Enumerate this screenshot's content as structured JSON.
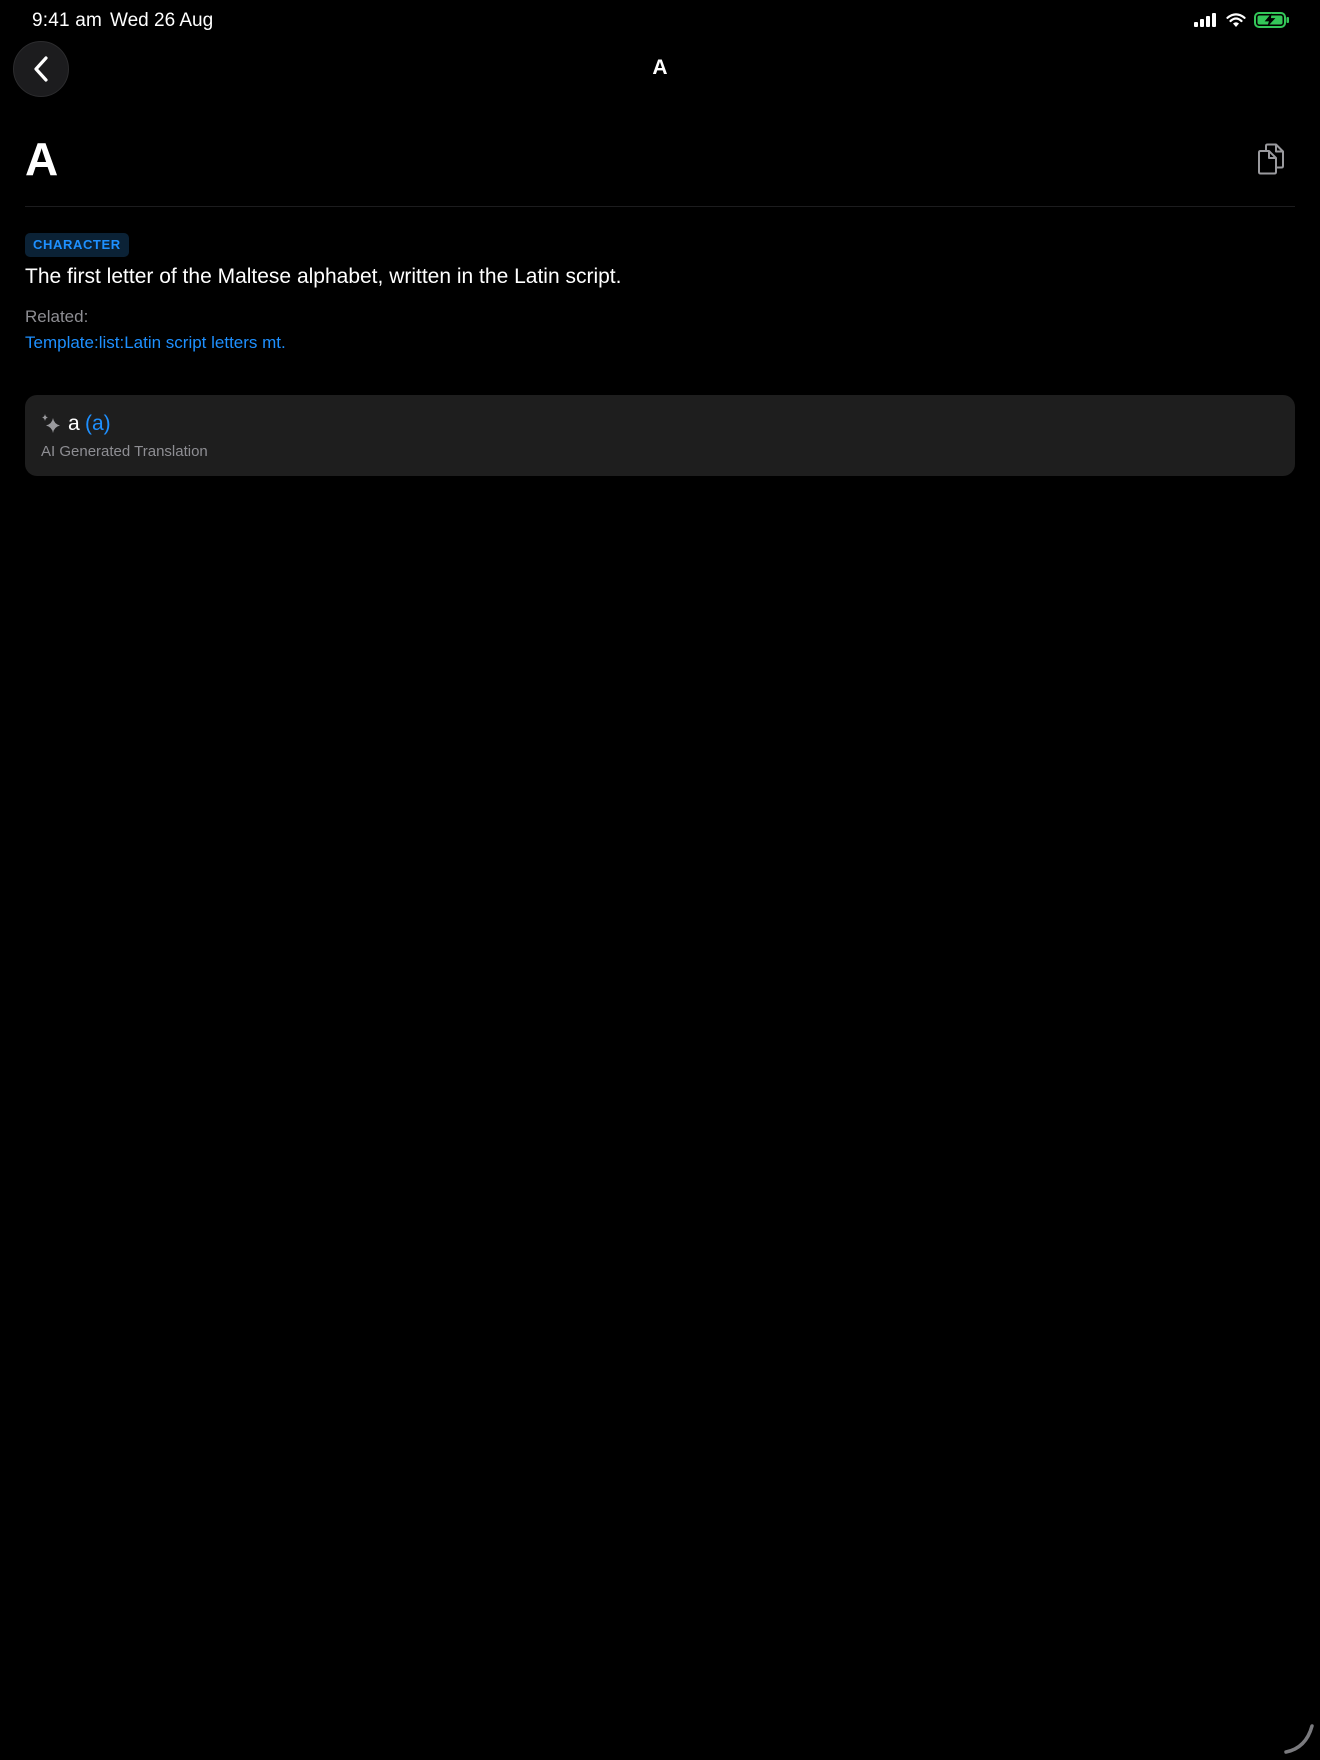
{
  "status_bar": {
    "time": "9:41 am",
    "date": "Wed 26 Aug",
    "battery_color": "#34c759"
  },
  "nav": {
    "title": "A",
    "back_icon": "chevron-left-icon"
  },
  "entry": {
    "word": "A",
    "copy_icon": "copy-icon",
    "part_of_speech": "CHARACTER",
    "definition": "The first letter of the Maltese alphabet, written in the Latin script.",
    "related_label": "Related:",
    "related_link": "Template:list:Latin script letters mt."
  },
  "translation": {
    "icon": "sparkles-icon",
    "word": "a",
    "romanization": "(a)",
    "source_label": "AI Generated Translation"
  },
  "colors": {
    "accent": "#1e90ff",
    "background": "#000000",
    "card": "#1e1e1e",
    "secondary_text": "#8e8e93"
  }
}
